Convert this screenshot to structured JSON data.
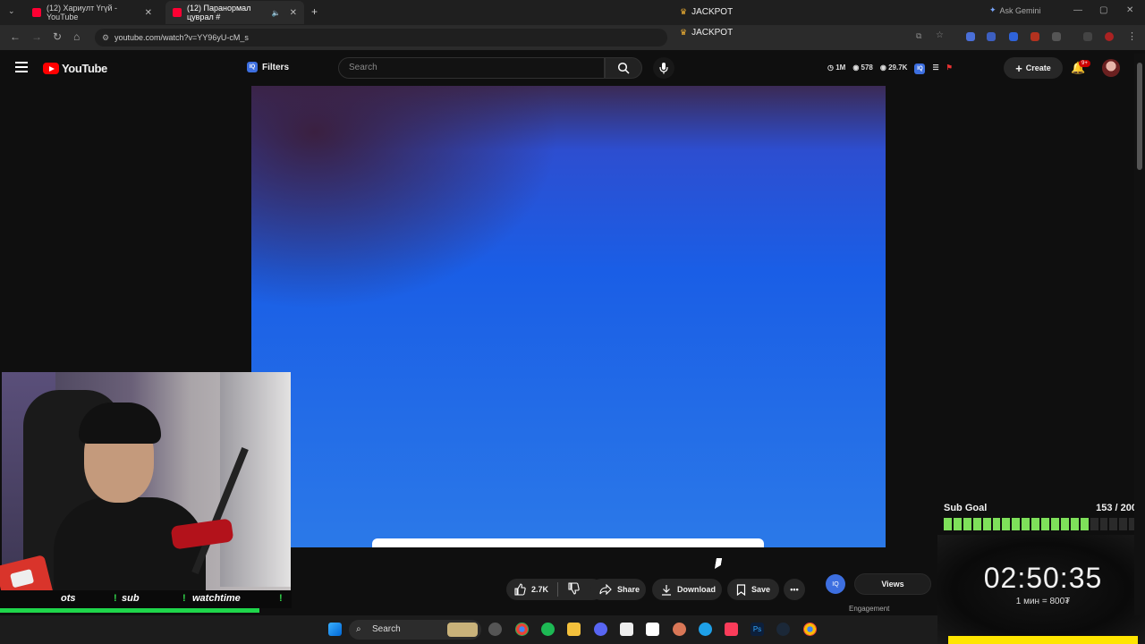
{
  "browser": {
    "tabs": [
      {
        "title": "(12) Хариулт Үгүй - YouTube"
      },
      {
        "title": "(12) Паранормал цуврал #"
      }
    ],
    "jackpot_1": "JACKPOT",
    "jackpot_2": "JACKPOT",
    "gemini": "Ask Gemini",
    "url": "youtube.com/watch?v=YY96yU-cM_s"
  },
  "youtube": {
    "logo_text": "YouTube",
    "filters_label": "Filters",
    "search_placeholder": "Search",
    "stats": {
      "a": "1M",
      "b": "578",
      "c": "29.7K"
    },
    "create_label": "Create",
    "notif_badge": "9+"
  },
  "actions": {
    "likes": "2.7K",
    "share": "Share",
    "download": "Download",
    "save": "Save"
  },
  "sidepanel": {
    "iq": "IQ",
    "views": "Views",
    "engagement": "Engagement"
  },
  "overlay": {
    "commands": [
      "ots",
      "!",
      "sub",
      "!",
      "watchtime",
      "!"
    ],
    "sub_goal_title": "Sub Goal",
    "sub_goal_count": "153 / 200",
    "sub_goal_progress": 0.765,
    "timer": "02:50:35",
    "timer_sub": "1 мин = 800₮"
  },
  "taskbar": {
    "search": "Search"
  },
  "colors": {
    "yt_red": "#ff0000",
    "goal_green": "#7ee05a",
    "accent_blue": "#3d6fe0",
    "timer_yellow": "#ffe500"
  }
}
